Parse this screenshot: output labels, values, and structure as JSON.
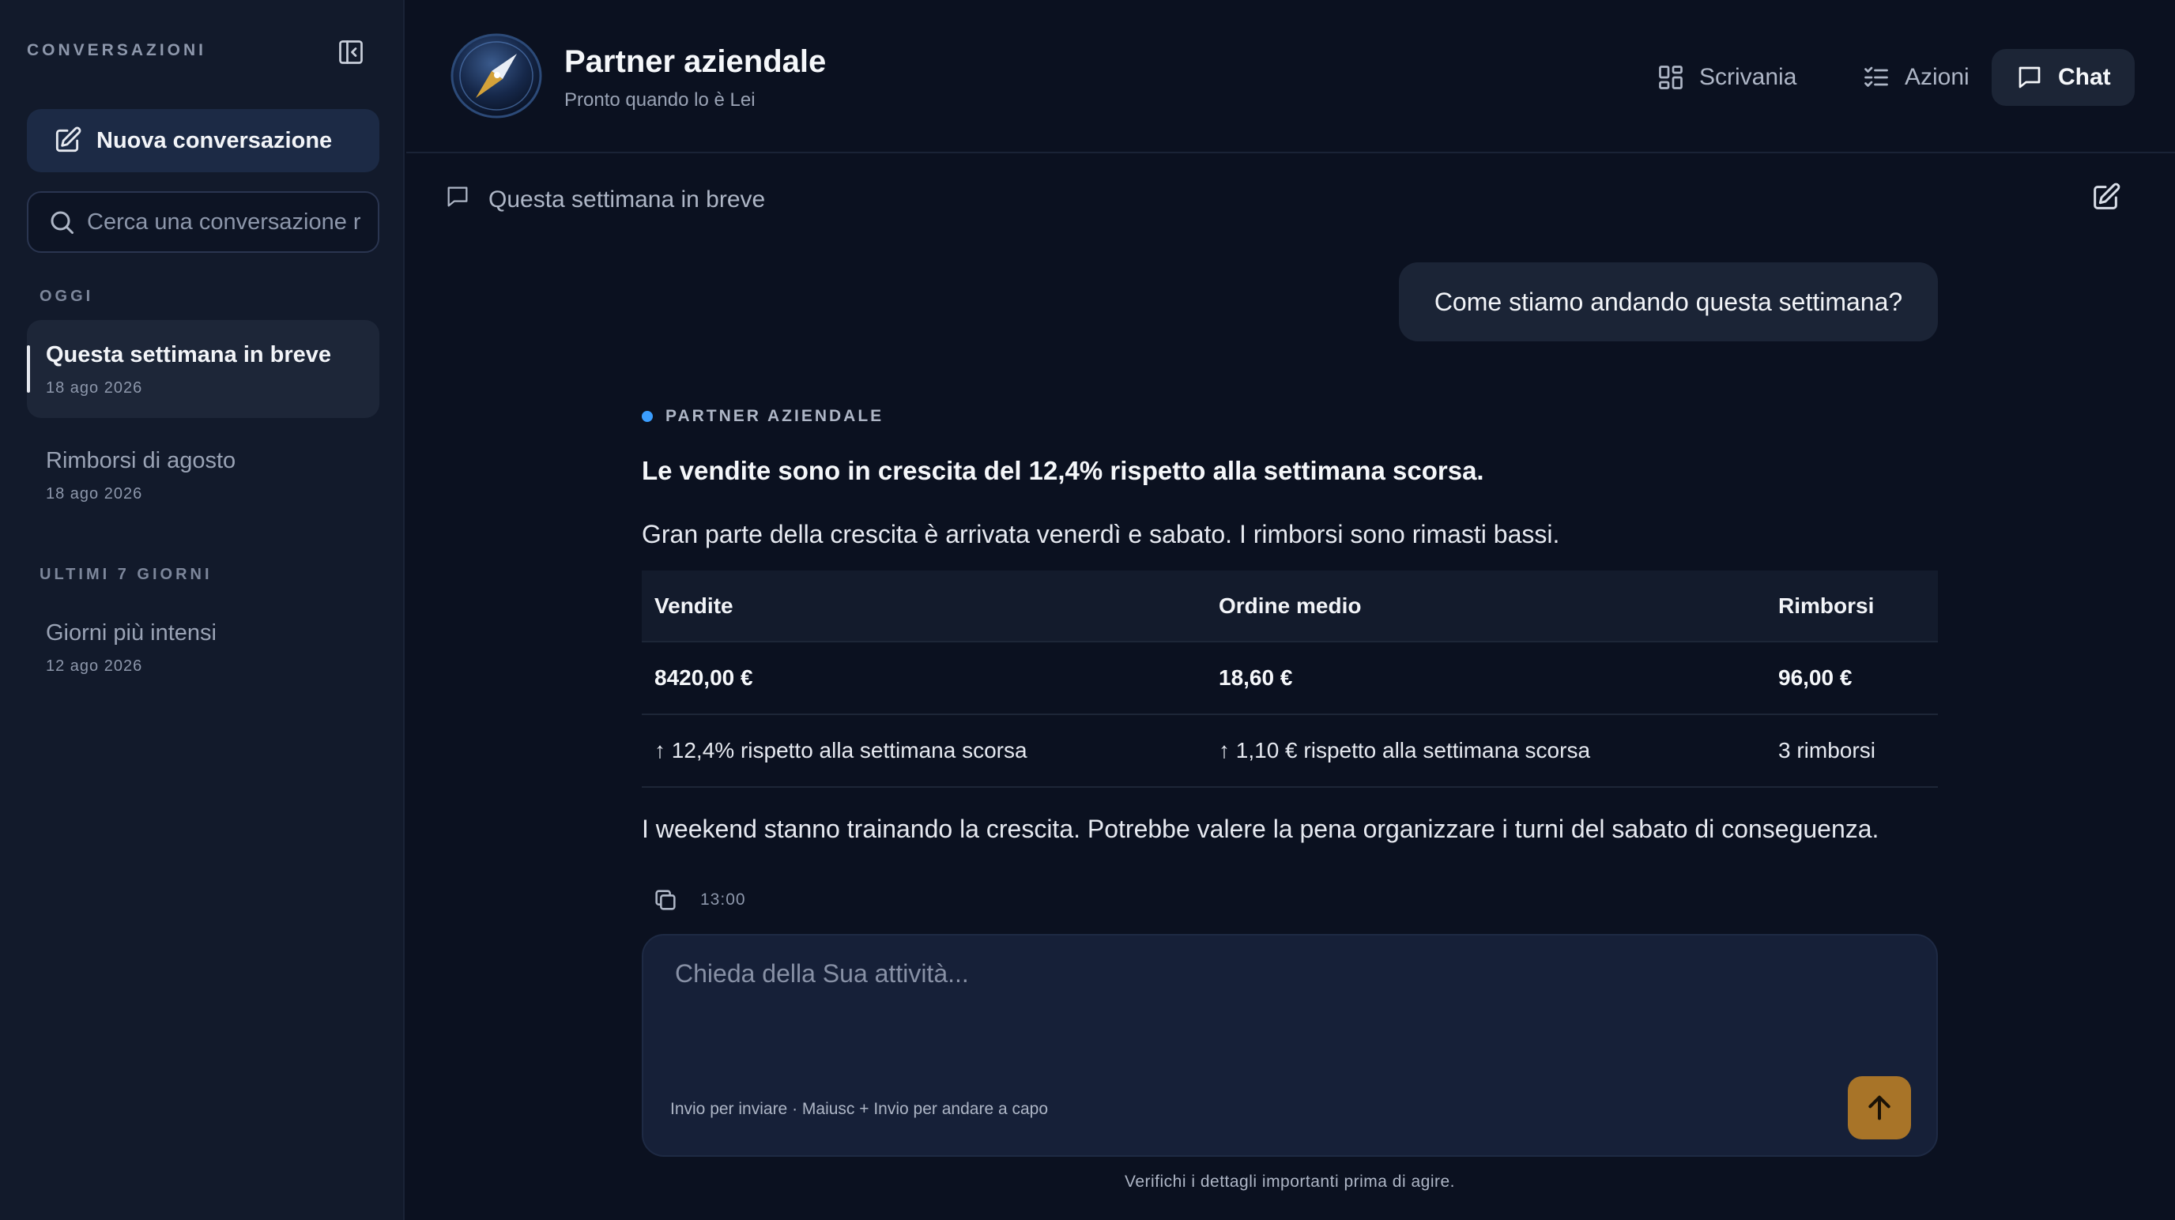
{
  "sidebar": {
    "header": "CONVERSAZIONI",
    "new_chat_label": "Nuova conversazione",
    "search_placeholder": "Cerca una conversazione r",
    "sections": [
      {
        "label": "OGGI",
        "items": [
          {
            "title": "Questa settimana in breve",
            "date": "18 ago 2026",
            "active": true
          },
          {
            "title": "Rimborsi di agosto",
            "date": "18 ago 2026",
            "active": false
          }
        ]
      },
      {
        "label": "ULTIMI 7 GIORNI",
        "items": [
          {
            "title": "Giorni più intensi",
            "date": "12 ago 2026",
            "active": false
          }
        ]
      }
    ]
  },
  "header": {
    "title": "Partner aziendale",
    "subtitle": "Pronto quando lo è Lei",
    "nav": [
      {
        "label": "Scrivania",
        "icon": "grid-icon",
        "active": false
      },
      {
        "label": "Azioni",
        "icon": "checklist-icon",
        "active": false
      },
      {
        "label": "Chat",
        "icon": "chat-bubble-icon",
        "active": true
      }
    ]
  },
  "conversation": {
    "title": "Questa settimana in breve",
    "user_message": "Come stiamo andando questa settimana?",
    "assistant": {
      "name": "PARTNER AZIENDALE",
      "headline": "Le vendite sono in crescita del 12,4% rispetto alla settimana scorsa.",
      "paragraph": "Gran parte della crescita è arrivata venerdì e sabato. I rimborsi sono rimasti bassi.",
      "table": {
        "headers": [
          "Vendite",
          "Ordine medio",
          "Rimborsi"
        ],
        "values": [
          "8420,00 €",
          "18,60 €",
          "96,00 €"
        ],
        "changes": [
          "↑ 12,4% rispetto alla settimana scorsa",
          "↑ 1,10 € rispetto alla settimana scorsa",
          "3 rimborsi"
        ]
      },
      "closing": "I weekend stanno trainando la crescita. Potrebbe valere la pena organizzare i turni del sabato di conseguenza.",
      "time": "13:00"
    }
  },
  "composer": {
    "placeholder": "Chieda della Sua attività...",
    "hint": "Invio per inviare · Maiusc + Invio per andare a capo",
    "disclaimer": "Verifichi i dettagli importanti prima di agire."
  },
  "colors": {
    "background": "#0b1120",
    "sidebar": "#121a2b",
    "accent_dot": "#3b9eff",
    "send_button": "#a87428"
  }
}
